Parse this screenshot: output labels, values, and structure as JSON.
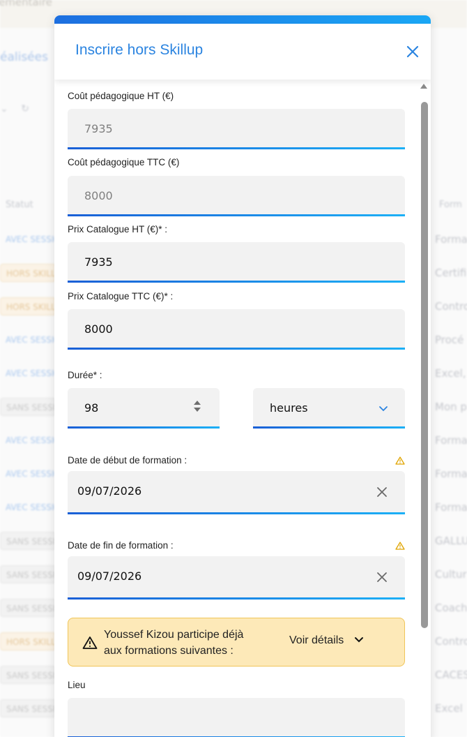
{
  "background": {
    "top_text": "ementaire",
    "tab_label": "éalisées",
    "status_header": "Statut",
    "formation_header": "Form",
    "rows": [
      {
        "badge": "AVEC SESSION",
        "kind": "avec",
        "right": "Forma"
      },
      {
        "badge": "HORS SKILLUP",
        "kind": "hors",
        "right": "Certifi"
      },
      {
        "badge": "HORS SKILLUP",
        "kind": "hors",
        "right": "Contro"
      },
      {
        "badge": "AVEC SESSION",
        "kind": "avec",
        "right": "Procé"
      },
      {
        "badge": "AVEC SESSION",
        "kind": "avec",
        "right": "Excel,"
      },
      {
        "badge": "SANS SESSION",
        "kind": "sans",
        "right": "Mon p"
      },
      {
        "badge": "AVEC SESSION",
        "kind": "avec",
        "right": "Forma"
      },
      {
        "badge": "AVEC SESSION",
        "kind": "avec",
        "right": "Forma"
      },
      {
        "badge": "AVEC SESSION",
        "kind": "avec",
        "right": "Forma"
      },
      {
        "badge": "SANS SESSION",
        "kind": "sans",
        "right": "GALLU"
      },
      {
        "badge": "SANS SESSION",
        "kind": "sans",
        "right": "Cultur"
      },
      {
        "badge": "SANS SESSION",
        "kind": "sans",
        "right": "Coach"
      },
      {
        "badge": "HORS SKILLUP",
        "kind": "hors",
        "right": "Contro"
      },
      {
        "badge": "SANS SESSION",
        "kind": "sans",
        "right": "CACES"
      },
      {
        "badge": "SANS SESSION",
        "kind": "sans",
        "right": "Excel"
      }
    ]
  },
  "modal": {
    "title": "Inscrire hors Skillup",
    "fields": {
      "cout_ht": {
        "label": "Coût pédagogique HT (€)",
        "value": "7935"
      },
      "cout_ttc": {
        "label": "Coût pédagogique TTC (€)",
        "value": "8000"
      },
      "prix_ht": {
        "label": "Prix Catalogue HT (€)* :",
        "value": "7935"
      },
      "prix_ttc": {
        "label": "Prix Catalogue TTC (€)* :",
        "value": "8000"
      },
      "duree": {
        "label": "Durée* :",
        "value": "98",
        "unit": "heures"
      },
      "date_debut": {
        "label": "Date de début de formation :",
        "value": "09/07/2026"
      },
      "date_fin": {
        "label": "Date de fin de formation :",
        "value": "09/07/2026"
      },
      "lieu": {
        "label": "Lieu",
        "value": ""
      }
    },
    "alert": {
      "line1": "Youssef Kizou participe déjà",
      "line2": "aux formations suivantes :",
      "link": "Voir détails"
    }
  },
  "colors": {
    "accent": "#2b84e0",
    "underline_start": "#1a5fd6",
    "underline_end": "#1cb0f6",
    "warning_bg": "#fde9b8",
    "warning_border": "#f0c558",
    "warning_icon": "#e0a400"
  },
  "icons": [
    "close-icon",
    "warning-icon",
    "clear-icon",
    "chevron-down-icon",
    "spinner-arrows-icon",
    "scroll-up-icon"
  ]
}
